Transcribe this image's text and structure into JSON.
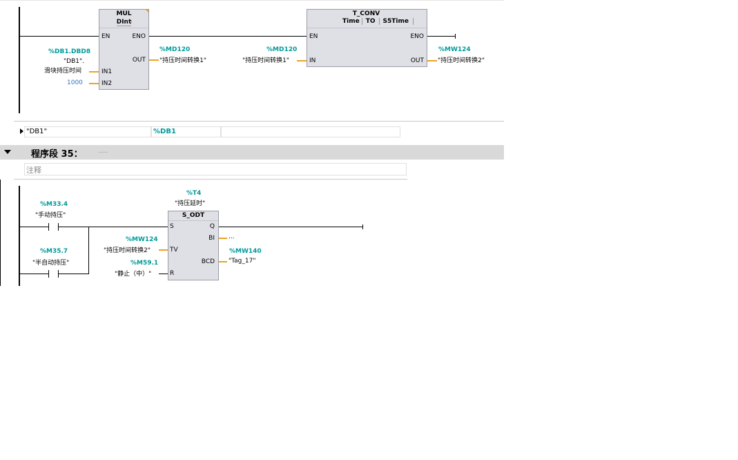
{
  "network34": {
    "mul": {
      "title": "MUL",
      "type": "DInt",
      "pins": {
        "en": "EN",
        "eno": "ENO",
        "out": "OUT",
        "in1": "IN1",
        "in2": "IN2"
      },
      "in1_address": "%DB1.DBD8",
      "in1_symbol_line1": "\"DB1\".",
      "in1_symbol_line2": "滑块持压时间",
      "in2_value": "1000",
      "out_address": "%MD120",
      "out_symbol": "\"持压时间转换1\""
    },
    "tconv": {
      "title": "T_CONV",
      "from_type": "Time",
      "to": "TO",
      "to_type": "S5Time",
      "pins": {
        "en": "EN",
        "eno": "ENO",
        "in": "IN",
        "out": "OUT"
      },
      "in_address": "%MD120",
      "in_symbol": "\"持压时间转换1\"",
      "out_address": "%MW124",
      "out_symbol": "\"持压时间转换2\""
    },
    "db_table": {
      "name": "\"DB1\"",
      "address": "%DB1"
    }
  },
  "network35": {
    "label": "程序段 35：",
    "title_placeholder": ".....",
    "comment_placeholder": "注释",
    "contact1": {
      "address": "%M33.4",
      "symbol": "\"手动持压\""
    },
    "contact2": {
      "address": "%M35.7",
      "symbol": "\"半自动持压\""
    },
    "timer": {
      "address": "%T4",
      "symbol": "\"持压延时\"",
      "title": "S_ODT",
      "pins": {
        "s": "S",
        "q": "Q",
        "tv": "TV",
        "bi": "BI",
        "r": "R",
        "bcd": "BCD"
      },
      "tv_address": "%MW124",
      "tv_symbol": "\"持压时间转换2\"",
      "r_address": "%M59.1",
      "r_symbol": "\"静止（中）\"",
      "bi_value": "...",
      "bcd_address": "%MW140",
      "bcd_symbol": "\"Tag_17\""
    }
  }
}
